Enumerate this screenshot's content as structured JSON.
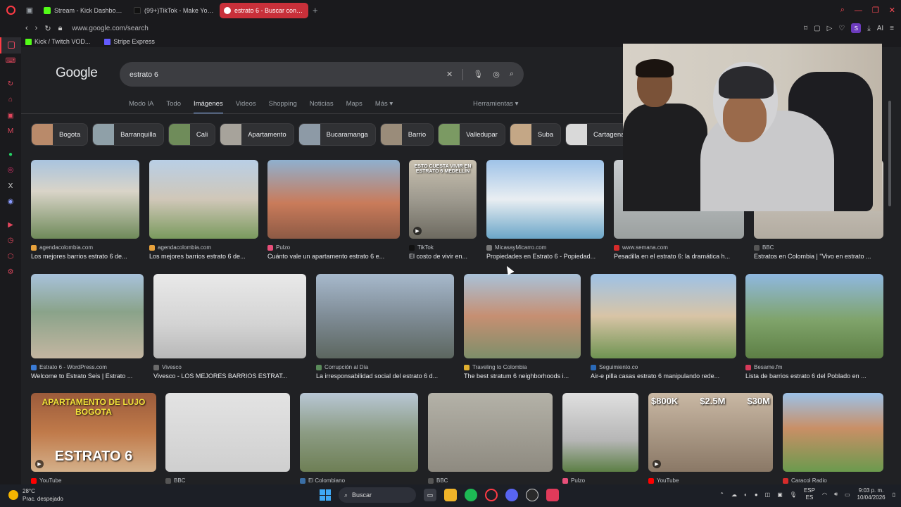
{
  "browser": {
    "tabs": [
      {
        "label": "Stream - Kick Dashboard",
        "fav_color": "#53fc18"
      },
      {
        "label": "(99+)TikTok - Make Your Day",
        "fav_color": "#111111"
      },
      {
        "label": "estrato 6 - Buscar con Google",
        "fav_color": "#ffffff"
      }
    ],
    "url": "www.google.com/search",
    "bookmarks": [
      {
        "label": "Kick / Twitch VOD...",
        "color": "#53fc18"
      },
      {
        "label": "Stripe Express",
        "color": "#635bff"
      }
    ],
    "profile_letter": "S",
    "ai_label": "AI"
  },
  "google": {
    "logo": "Google",
    "query": "estrato 6",
    "tabs": [
      "Modo IA",
      "Todo",
      "Imágenes",
      "Videos",
      "Shopping",
      "Noticias",
      "Maps",
      "Más"
    ],
    "active_tab": "Imágenes",
    "tools": "Herramientas",
    "chips": [
      {
        "label": "Bogota",
        "color": "#b98a6a"
      },
      {
        "label": "Barranquilla",
        "color": "#8fa0a8"
      },
      {
        "label": "Cali",
        "color": "#6f8c5a"
      },
      {
        "label": "Apartamento",
        "color": "#a7a39b"
      },
      {
        "label": "Bucaramanga",
        "color": "#8d9aa6"
      },
      {
        "label": "Barrio",
        "color": "#9a8c7a"
      },
      {
        "label": "Valledupar",
        "color": "#7b9a63"
      },
      {
        "label": "Suba",
        "color": "#c4a786"
      },
      {
        "label": "Cartagena",
        "color": "#d9d9d9"
      }
    ],
    "results": [
      [
        {
          "source": "agendacolombia.com",
          "title": "Los mejores barrios estrato 6 de...",
          "fav": "#e8a23c",
          "bg": "linear-gradient(180deg,#a9c4df 0%,#d9d4c8 40%,#6f8a5a 100%)"
        },
        {
          "source": "agendacolombia.com",
          "title": "Los mejores barrios estrato 6 de...",
          "fav": "#e8a23c",
          "bg": "linear-gradient(180deg,#b9cfe6 0%,#d0c7b8 50%,#7a9a5e 100%)"
        },
        {
          "source": "Pulzo",
          "title": "Cuánto vale un apartamento estrato 6 e...",
          "fav": "#e84f7a",
          "bg": "linear-gradient(180deg,#8fb0cf 0%,#c97b5a 55%,#8d5a45 100%)"
        },
        {
          "source": "TikTok",
          "title": "El costo de vivir en...",
          "fav": "#111111",
          "bg": "linear-gradient(180deg,#c9c1b0 0%,#9e9a8f 50%,#6d6a60 100%)",
          "overlay": "ESTO CUESTA VIVIR EN ESTRATO 6 MEDELLÍN",
          "video": true
        },
        {
          "source": "MicasayMicarro.com",
          "title": "Propiedades en Estrato 6 - Popiedad...",
          "fav": "#777777",
          "bg": "linear-gradient(180deg,#9fc3e8 0%,#e9eef2 50%,#6ba6c8 100%)"
        },
        {
          "source": "www.semana.com",
          "title": "Pesadilla en el estrato 6: la dramática h...",
          "fav": "#d62b2b",
          "bg": "linear-gradient(180deg,#c8ccd0 0%,#9ba09f 100%)"
        },
        {
          "source": "BBC",
          "title": "Estratos en Colombia | \"Vivo en estrato ...",
          "fav": "#555555",
          "bg": "linear-gradient(180deg,#d6d1c9 0%,#b2aba0 100%)"
        }
      ],
      [
        {
          "source": "Estrato 6 - WordPress.com",
          "title": "Welcome to Estrato Seis | Estrato ...",
          "fav": "#3a7bd5",
          "bg": "linear-gradient(180deg,#a8c2db 0%,#8aa38a 45%,#c4b6a1 100%)"
        },
        {
          "source": "Vivesco",
          "title": "Vivesco - LOS MEJORES BARRIOS ESTRAT...",
          "fav": "#6a6a6a",
          "bg": "linear-gradient(180deg,#e9e9e9 0%,#d3d3d3 60%,#b8b8b8 100%)"
        },
        {
          "source": "Corrupción al Día",
          "title": "La irresponsabilidad social del estrato 6 d...",
          "fav": "#5a8a5a",
          "bg": "linear-gradient(180deg,#a7b9cc 0%,#7f8c96 50%,#5c665f 100%)"
        },
        {
          "source": "Traveling to Colombia",
          "title": "The best stratum 6 neighborhoods i...",
          "fav": "#e0b030",
          "bg": "linear-gradient(180deg,#a9c2d9 0%,#c68f72 50%,#7e8f6a 100%)"
        },
        {
          "source": "Seguimiento.co",
          "title": "Air-e pilla casas estrato 6 manipulando rede...",
          "fav": "#2a6ab8",
          "bg": "linear-gradient(180deg,#9ec2e6 0%,#d8c4a6 50%,#6f9452 100%)"
        },
        {
          "source": "Besame.fm",
          "title": "Lista de barrios estrato 6 del Poblado en ...",
          "fav": "#d63a5a",
          "bg": "linear-gradient(180deg,#8fb8e0 0%,#7fa36a 55%,#5d7f45 100%)"
        }
      ],
      [
        {
          "source": "YouTube",
          "title": "",
          "fav": "#ff0000",
          "bg": "linear-gradient(180deg,#9b5b3b 0%,#c07a4a 50%,#d4b08a 100%)",
          "overlay_top": "APARTAMENTO DE LUJO BOGOTA",
          "overlay_bottom": "ESTRATO 6",
          "video": true
        },
        {
          "source": "BBC",
          "title": "",
          "fav": "#555555",
          "bg": "linear-gradient(180deg,#e3e3e3 0%,#cfcfcf 100%)"
        },
        {
          "source": "El Colombiano",
          "title": "",
          "fav": "#3a6ea5",
          "bg": "linear-gradient(180deg,#b8c7d5 0%,#8c9c84 50%,#6e7f55 100%)"
        },
        {
          "source": "BBC",
          "title": "",
          "fav": "#555555",
          "bg": "linear-gradient(180deg,#b4b2a8 0%,#8e8a80 100%)"
        },
        {
          "source": "Pulzo",
          "title": "",
          "fav": "#e84f7a",
          "bg": "linear-gradient(180deg,#e0e0e0 0%,#b6b6b6 60%,#5c7f45 100%)"
        },
        {
          "source": "YouTube",
          "title": "",
          "fav": "#ff0000",
          "bg": "linear-gradient(180deg,#c9b8a4 0%,#8a7866 100%)",
          "overlay_prices": [
            "$800K",
            "$2.5M",
            "$30M"
          ],
          "video": true
        },
        {
          "source": "Caracol Radio",
          "title": "",
          "fav": "#d62b2b",
          "bg": "linear-gradient(180deg,#9cc2e8 0%,#c98f66 45%,#6b9a4e 100%)"
        }
      ]
    ]
  },
  "taskbar": {
    "weather_temp": "28°C",
    "weather_desc": "Prac. despejado",
    "search_label": "Buscar",
    "lang_top": "ESP",
    "lang_bottom": "ES",
    "time": "9:03 p. m.",
    "date": "10/04/2026"
  }
}
